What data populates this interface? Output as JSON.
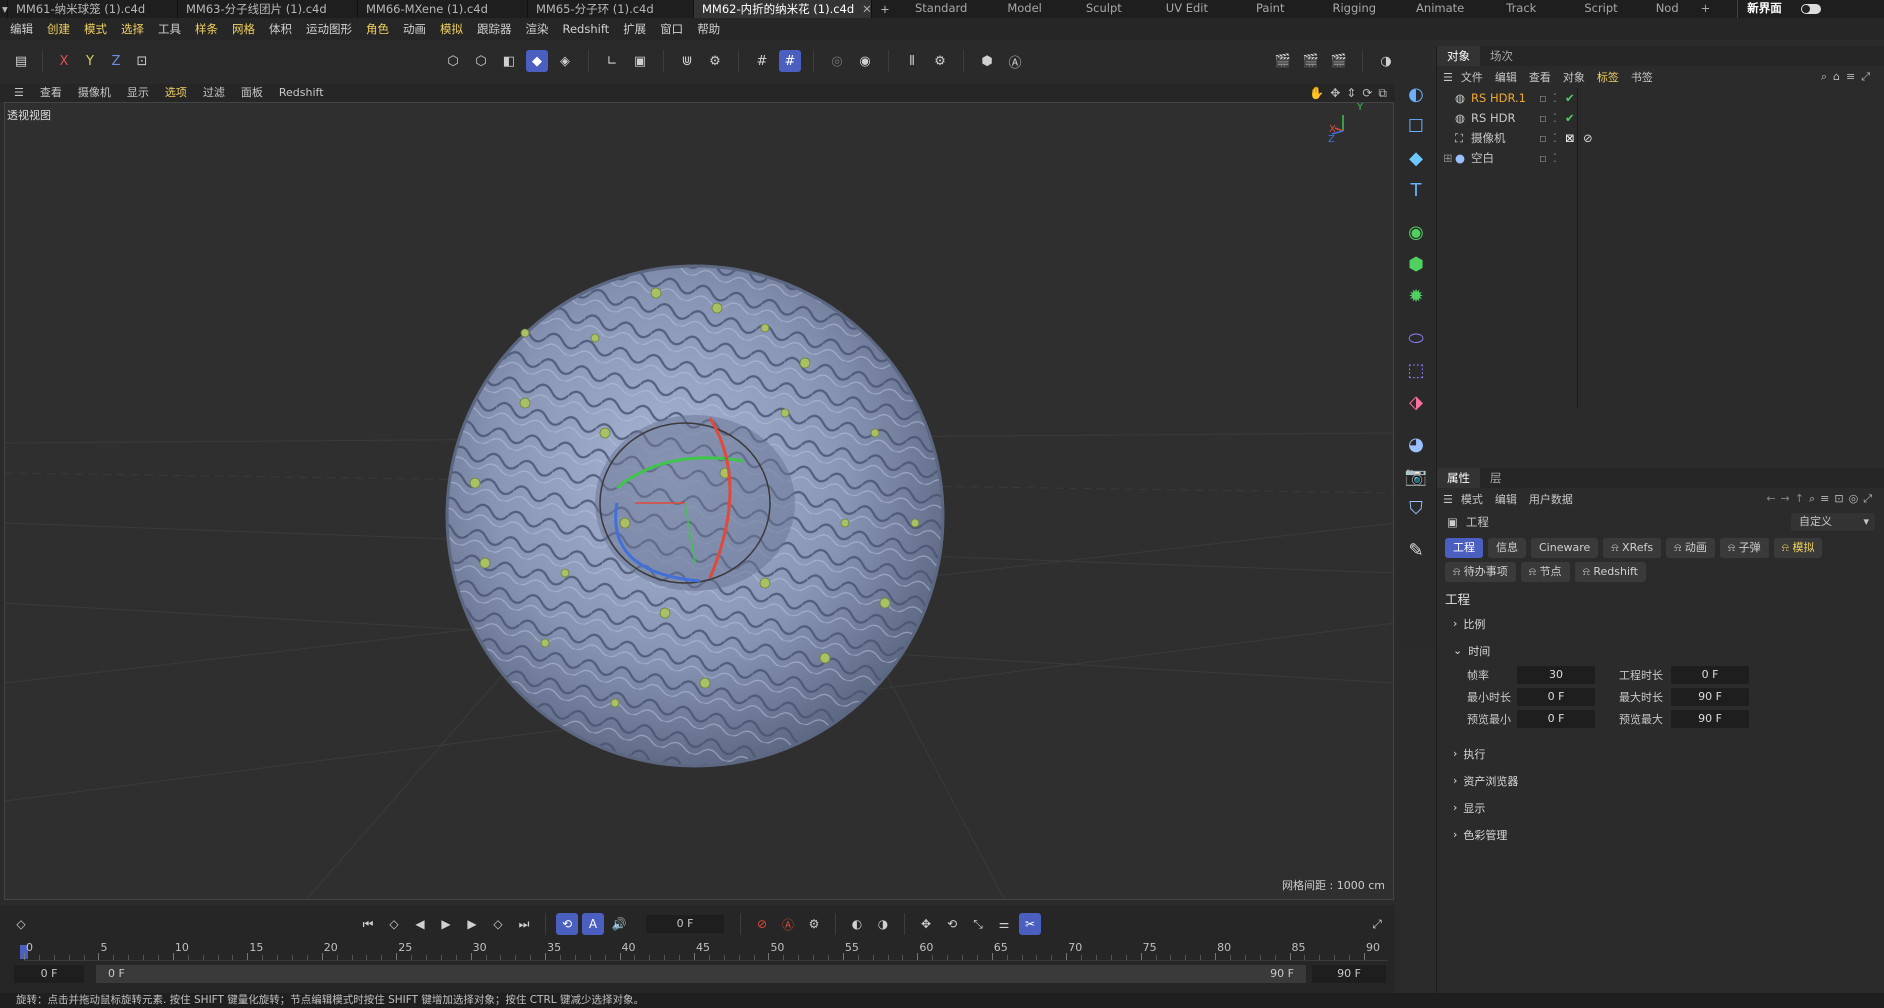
{
  "doc_tabs": [
    {
      "label": "MM61-纳米球笼 (1).c4d",
      "active": false
    },
    {
      "label": "MM63-分子线团片 (1).c4d",
      "active": false
    },
    {
      "label": "MM66-MXene (1).c4d",
      "active": false
    },
    {
      "label": "MM65-分子环 (1).c4d",
      "active": false
    },
    {
      "label": "MM62-内折的纳米花 (1).c4d",
      "active": true
    }
  ],
  "layout_tabs": [
    "Standard",
    "Model",
    "Sculpt",
    "UV Edit",
    "Paint",
    "Rigging",
    "Animate",
    "Track",
    "Script",
    "Nod"
  ],
  "new_layout_label": "新界面",
  "menu": [
    {
      "label": "编辑",
      "hl": false
    },
    {
      "label": "创建",
      "hl": true
    },
    {
      "label": "模式",
      "hl": true
    },
    {
      "label": "选择",
      "hl": true
    },
    {
      "label": "工具",
      "hl": false
    },
    {
      "label": "样条",
      "hl": true
    },
    {
      "label": "网格",
      "hl": true
    },
    {
      "label": "体积",
      "hl": false
    },
    {
      "label": "运动图形",
      "hl": false
    },
    {
      "label": "角色",
      "hl": true
    },
    {
      "label": "动画",
      "hl": false
    },
    {
      "label": "模拟",
      "hl": true
    },
    {
      "label": "跟踪器",
      "hl": false
    },
    {
      "label": "渲染",
      "hl": false
    },
    {
      "label": "Redshift",
      "hl": false
    },
    {
      "label": "扩展",
      "hl": false
    },
    {
      "label": "窗口",
      "hl": false
    },
    {
      "label": "帮助",
      "hl": false
    }
  ],
  "axis_buttons": [
    "X",
    "Y",
    "Z"
  ],
  "viewport_menu": [
    {
      "label": "查看",
      "hl": false
    },
    {
      "label": "摄像机",
      "hl": false
    },
    {
      "label": "显示",
      "hl": false
    },
    {
      "label": "选项",
      "hl": true
    },
    {
      "label": "过滤",
      "hl": false
    },
    {
      "label": "面板",
      "hl": false
    },
    {
      "label": "Redshift",
      "hl": false
    }
  ],
  "viewport": {
    "label": "透视视图",
    "grid_spacing": "网格间距 : 1000 cm",
    "axis_x": "X",
    "axis_y": "Y",
    "axis_z": "Z"
  },
  "object_manager": {
    "tabs": [
      "对象",
      "场次"
    ],
    "menu": [
      "文件",
      "编辑",
      "查看",
      "对象",
      "标签",
      "书签"
    ],
    "objects": [
      {
        "name": "RS HDR.1",
        "selected": true
      },
      {
        "name": "RS HDR",
        "selected": false
      },
      {
        "name": "摄像机",
        "selected": false
      },
      {
        "name": "空白",
        "selected": false
      }
    ]
  },
  "attributes": {
    "tabs": [
      "属性",
      "层"
    ],
    "menu": [
      "模式",
      "编辑",
      "用户数据"
    ],
    "mode_label": "工程",
    "preset": "自定义",
    "chips_row1": [
      {
        "label": "工程",
        "active": true
      },
      {
        "label": "信息",
        "active": false
      },
      {
        "label": "Cineware",
        "active": false
      },
      {
        "label": "XRefs",
        "active": false
      },
      {
        "label": "动画",
        "active": false
      },
      {
        "label": "子弹",
        "active": false
      },
      {
        "label": "模拟",
        "active": false
      }
    ],
    "chips_row2": [
      {
        "label": "待办事项",
        "active": false
      },
      {
        "label": "节点",
        "active": false
      },
      {
        "label": "Redshift",
        "active": false
      }
    ],
    "section_title": "工程",
    "sections": [
      {
        "label": "比例",
        "open": false
      },
      {
        "label": "时间",
        "open": true
      }
    ],
    "time_fields": [
      {
        "label": "帧率",
        "value": "30",
        "label2": "工程时长",
        "value2": "0 F"
      },
      {
        "label": "最小时长",
        "value": "0 F",
        "label2": "最大时长",
        "value2": "90 F"
      },
      {
        "label": "预览最小",
        "value": "0 F",
        "label2": "预览最大",
        "value2": "90 F"
      }
    ],
    "sections_after": [
      "执行",
      "资产浏览器",
      "显示",
      "色彩管理"
    ]
  },
  "timeline": {
    "current_frame": "0 F",
    "ruler": [
      "0",
      "5",
      "10",
      "15",
      "20",
      "25",
      "30",
      "35",
      "40",
      "45",
      "50",
      "55",
      "60",
      "65",
      "70",
      "75",
      "80",
      "85",
      "90"
    ],
    "range_start": "0 F",
    "range_inner_start": "0 F",
    "range_inner_end": "90 F",
    "range_end": "90 F"
  },
  "status": "旋转：点击并拖动鼠标旋转元素. 按住 SHIFT 键量化旋转；节点编辑模式时按住 SHIFT 键增加选择对象；按住 CTRL 键减少选择对象。",
  "colors": {
    "accent": "#4a5fbf",
    "highlight": "#f0d060",
    "object_orange": "#f0a830",
    "sphere": "#8f9dbd"
  }
}
